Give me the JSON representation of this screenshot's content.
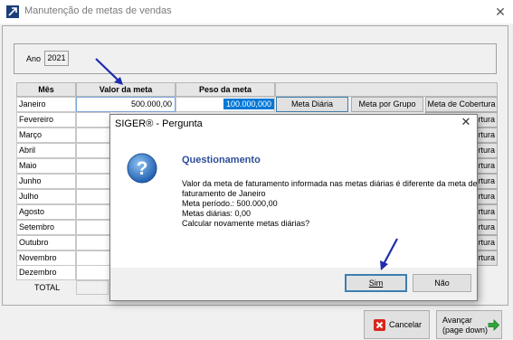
{
  "window": {
    "title": "Manutenção de metas de vendas",
    "close_glyph": "✕"
  },
  "year": {
    "label": "Ano",
    "value": "2021"
  },
  "grid": {
    "headers": {
      "month": "Mês",
      "goal_value": "Valor da meta",
      "weight": "Peso da meta"
    },
    "row_buttons": {
      "daily": "Meta Diária",
      "by_group": "Meta por Grupo",
      "coverage": "Meta de Cobertura"
    },
    "first_row": {
      "goal_value": "500.000,00",
      "weight": "100.000,000"
    },
    "months": [
      "Janeiro",
      "Fevereiro",
      "Março",
      "Abril",
      "Maio",
      "Junho",
      "Julho",
      "Agosto",
      "Setembro",
      "Outubro",
      "Novembro",
      "Dezembro"
    ],
    "covered_coverage_label": "ertura",
    "total_label": "TOTAL"
  },
  "footer": {
    "cancel": "Cancelar",
    "next_line1": "Avançar",
    "next_line2": "(page down)"
  },
  "dialog": {
    "title": "SIGER® - Pergunta",
    "close_glyph": "✕",
    "heading": "Questionamento",
    "message_lines": [
      "Valor da meta de faturamento informada nas metas diárias é diferente da meta de",
      "faturamento de Janeiro",
      "Meta período.: 500.000,00",
      "Metas diárias: 0,00",
      "Calcular novamente metas diárias?"
    ],
    "yes": "Sim",
    "no": "Não"
  },
  "colors": {
    "accent": "#0078d7",
    "heading": "#2e4e9a",
    "arrow": "#1f2cad",
    "selection": "#0078d7"
  }
}
